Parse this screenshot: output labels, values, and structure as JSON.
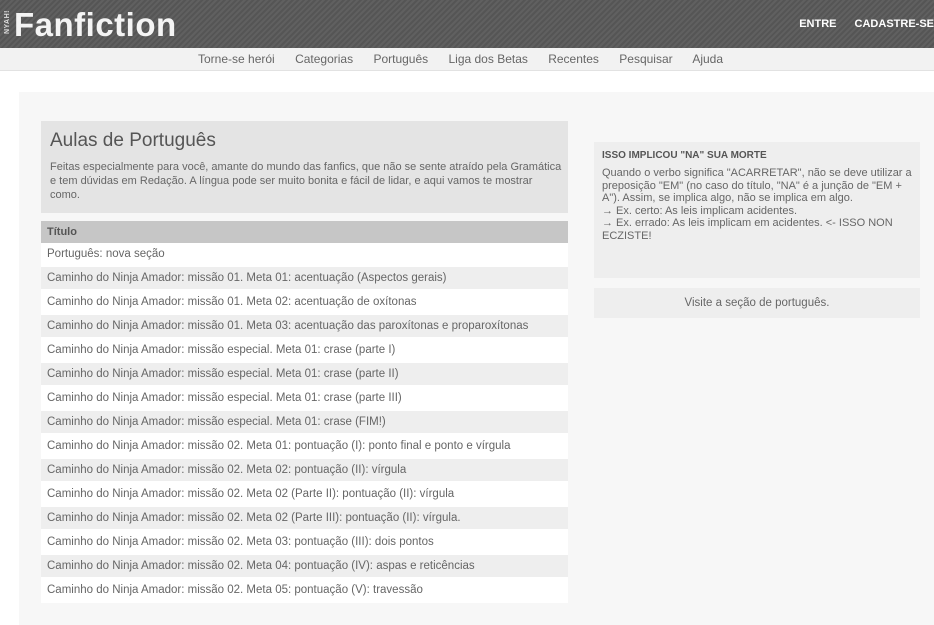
{
  "brand": {
    "small_label": "NYAH!",
    "logo_text": "Fanfiction"
  },
  "auth": {
    "login_label": "ENTRE",
    "signup_label": "CADASTRE-SE"
  },
  "nav": {
    "items": [
      "Torne-se herói",
      "Categorias",
      "Português",
      "Liga dos Betas",
      "Recentes",
      "Pesquisar",
      "Ajuda"
    ]
  },
  "header": {
    "title": "Aulas de Português",
    "description": "Feitas especialmente para você, amante do mundo das fanfics, que não se sente atraído pela Gramática e tem dúvidas em Redação. A língua pode ser muito bonita e fácil de lidar, e aqui vamos te mostrar como."
  },
  "table": {
    "column_header": "Título",
    "rows": [
      "Português: nova seção",
      "Caminho do Ninja Amador: missão 01. Meta 01: acentuação (Aspectos gerais)",
      "Caminho do Ninja Amador: missão 01. Meta 02: acentuação de oxítonas",
      "Caminho do Ninja Amador: missão 01. Meta 03: acentuação das paroxítonas e proparoxítonas",
      "Caminho do Ninja Amador: missão especial. Meta 01: crase (parte I)",
      "Caminho do Ninja Amador: missão especial. Meta 01: crase (parte II)",
      "Caminho do Ninja Amador: missão especial. Meta 01: crase (parte III)",
      "Caminho do Ninja Amador: missão especial. Meta 01: crase (FIM!)",
      "Caminho do Ninja Amador: missão 02. Meta 01: pontuação (I): ponto final e ponto e vírgula",
      "Caminho do Ninja Amador: missão 02. Meta 02: pontuação (II): vírgula",
      "Caminho do Ninja Amador: missão 02. Meta 02 (Parte II): pontuação (II): vírgula",
      "Caminho do Ninja Amador: missão 02. Meta 02 (Parte III): pontuação (II): vírgula.",
      "Caminho do Ninja Amador: missão 02. Meta 03: pontuação (III): dois pontos",
      "Caminho do Ninja Amador: missão 02. Meta 04: pontuação (IV): aspas e reticências",
      "Caminho do Ninja Amador: missão 02. Meta 05: pontuação (V): travessão"
    ]
  },
  "sidebar": {
    "title": "ISSO IMPLICOU \"NA\" SUA MORTE",
    "lines": [
      "Quando o verbo significa \"ACARRETAR\", não se deve utilizar a preposição \"EM\" (no caso do título, \"NA\" é a junção de \"EM + A\"). Assim, se implica algo, não se implica em algo.",
      "→ Ex. certo: As leis implicam acidentes.",
      "→ Ex. errado: As leis implicam em acidentes. <- ISSO NON ECZISTE!"
    ],
    "link_label": "Visite a seção de português."
  }
}
